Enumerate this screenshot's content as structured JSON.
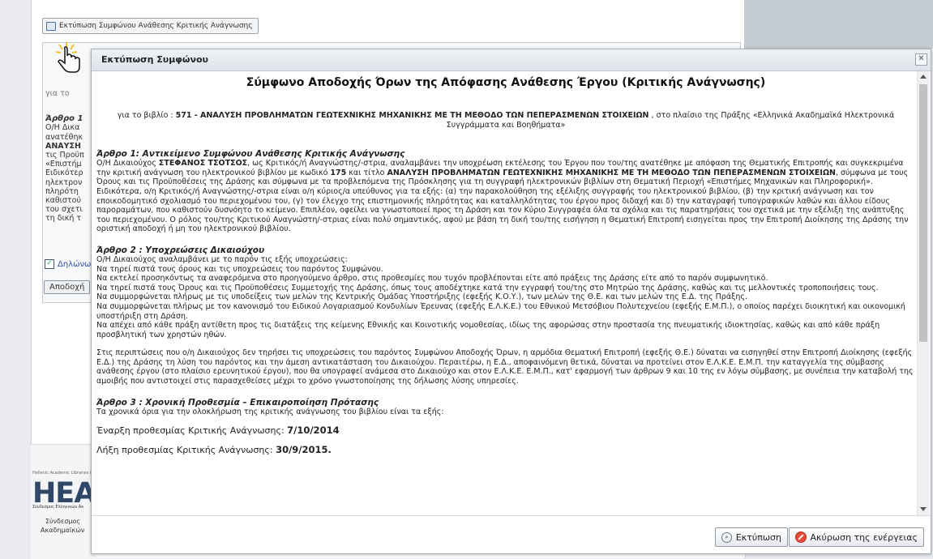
{
  "background": {
    "print_button_label": "Εκτύπωση Συμφώνου Ανάθεσης Κριτικής Ανάγνωσης",
    "side_text": [
      "για το",
      "Άρθρο 1",
      "Ο/Η Δικα",
      "ανατέθηκ",
      "ΑΝΑΥΣΗ",
      "τις Προϋπ",
      "«Επιστήμ",
      "Ειδικότερ",
      "ηλεκτρον",
      "πληρότη",
      "καθιστού",
      "του σχετι",
      "τη δική τ"
    ],
    "declaration_label": "Δηλώνω",
    "accept_button": "Αποδοχή",
    "footer": {
      "tiny": "Hellenic Academic Libraries Link",
      "logo": "HEAL",
      "sub": "Σύνδεσμος Ελληνικών Ακ",
      "line1": "Σύνδεσμος",
      "line2": "Ακαδημαϊκών"
    }
  },
  "dialog": {
    "title": "Εκτύπωση Συμφώνου",
    "close": "✕",
    "heading": "Σύμφωνο Αποδοχής Όρων της Απόφασης Ανάθεσης Έργου (Κριτικής Ανάγνωσης)",
    "intro": {
      "prefix": "για το βιβλίο : ",
      "book": "571 - ΑΝΑΛΥΣΗ ΠΡΟΒΛΗΜΑΤΩΝ ΓΕΩΤΕΧΝΙΚΗΣ ΜΗΧΑΝΙΚΗΣ ΜΕ ΤΗ ΜΕΘΟΔΟ ΤΩΝ ΠΕΠΕΡΑΣΜΕΝΩΝ ΣΤΟΙΧΕΙΩΝ",
      "suffix": " , στο πλαίσιο της Πράξης «Ελληνικά Ακαδημαϊκά Ηλεκτρονικά Συγγράμματα και Βοηθήματα»"
    },
    "article1": {
      "title": "Άρθρο 1: Αντικείμενο Συμφώνου Ανάθεσης Κριτικής Ανάγνωσης",
      "p1_a": "Ο/Η Δικαιούχος ",
      "name": "ΣΤΕΦΑΝΟΣ ΤΣΟΤΣΟΣ",
      "p1_b": ", ως Κριτικός/ή Αναγνώστης/-στρια, αναλαμβάνει την υποχρέωση εκτέλεσης του Έργου που του/της ανατέθηκε με απόφαση της Θεματικής Επιτροπής και συγκεκριμένα την κριτική ανάγνωση του ηλεκτρονικού βιβλίου με κωδικό ",
      "code": "175",
      "p1_c": " και τίτλο ",
      "title_book": "ΑΝΑΛΥΣΗ ΠΡΟΒΛΗΜΑΤΩΝ ΓΕΩΤΕΧΝΙΚΗΣ ΜΗΧΑΝΙΚΗΣ ΜΕ ΤΗ ΜΕΘΟΔΟ ΤΩΝ ΠΕΠΕΡΑΣΜΕΝΩΝ ΣΤΟΙΧΕΙΩΝ",
      "p1_d": ", σύμφωνα με τους Όρους και τις Προϋποθέσεις της Δράσης και σύμφωνα με τα προβλεπόμενα της Πρόσκλησης για τη συγγραφή ηλεκτρονικών βιβλίων στη Θεματική Περιοχή «Επιστήμες Μηχανικών και Πληροφορική».",
      "p2": "Ειδικότερα, ο/η Κριτικός/ή Αναγνώστης/-στρια είναι ο/η κύριος/α υπεύθυνος για τα εξής: (α) την παρακολούθηση της εξέλιξης συγγραφής του ηλεκτρονικού βιβλίου, (β) την κριτική ανάγνωση και τον εποικοδομητικό σχολιασμό του περιεχομένου του, (γ) τον έλεγχο της επιστημονικής πληρότητας και καταλληλότητας του έργου προς διδαχή και δ) την καταγραφή τυπογραφικών λαθών και άλλου είδους παροραμάτων, που καθιστούν δυσνόητο το κείμενο. Επιπλέον, οφείλει να γνωστοποιεί προς τη Δράση και τον Κύριο Συγγραφέα όλα τα σχόλια και τις παρατηρήσεις του σχετικά με την εξέλιξη της ανάπτυξης του περιεχομένου. Ο ρόλος του/της Κριτικού Αναγνώστη/-στριας είναι πολύ σημαντικός, αφού με βάση τη δική του/της εισήγηση η Θεματική Επιτροπή εισηγείται προς την Επιτροπή Διοίκησης της Δράσης την οριστική αποδοχή ή μη του ηλεκτρονικού βιβλίου."
    },
    "article2": {
      "title": "Άρθρο 2 : Υποχρεώσεις Δικαιούχου",
      "lines": [
        "Ο/Η Δικαιούχος αναλαμβάνει με το παρόν τις εξής υποχρεώσεις:",
        "Να τηρεί πιστά τους όρους και τις υποχρεώσεις του παρόντος Συμφώνου.",
        "Να εκτελεί προσηκόντως τα αναφερόμενα στο προηγούμενο άρθρο, στις προθεσμίες που τυχόν προβλέπονται είτε από πράξεις της Δράσης είτε από το παρόν συμφωνητικό.",
        "Να τηρεί πιστά τους Όρους και τις Προϋποθέσεις Συμμετοχής της Δράσης, όπως τους αποδέχτηκε κατά την εγγραφή του/της στο Μητρώο της Δράσης, καθώς και τις μελλοντικές τροποποιήσεις τους.",
        "Να συμμορφώνεται πλήρως με τις υποδείξεις των μελών της Κεντρικής Ομάδας Υποστήριξης (εφεξής Κ.Ο.Υ.), των μελών της Θ.Ε. και των μελών της Ε.Δ. της Πράξης.",
        "Να συμμορφώνεται πλήρως με τον κανονισμό του Ειδικού Λογαριασμού Κονδυλίων Έρευνας (εφεξής Ε.Λ.Κ.Ε.) του Εθνικού Μετσόβιου Πολυτεχνείου (εφεξής Ε.Μ.Π.), ο οποίος παρέχει διοικητική και οικονομική υποστήριξη στη Δράση.",
        "Να απέχει από κάθε πράξη αντίθετη προς τις διατάξεις της κείμενης Εθνικής και Κοινοτικής νομοθεσίας, ιδίως της αφορώσας στην προστασία της πνευματικής ιδιοκτησίας, καθώς και από κάθε πράξη προσβλητική των χρηστών ηθών."
      ],
      "closing": "Στις περιπτώσεις που ο/η Δικαιούχος δεν τηρήσει τις υποχρεώσεις του παρόντος Συμφώνου Αποδοχής Όρων, η αρμόδια Θεματική Επιτροπή (εφεξής Θ.Ε.) δύναται να εισηγηθεί στην Επιτροπή Διοίκησης (εφεξής Ε.Δ.) της Δράσης τη λύση του παρόντος και την άμεση αντικατάσταση του Δικαιούχου. Περαιτέρω, η Ε.Δ., αποφαινόμενη θετικά, δύναται να προτείνει στον Ε.Λ.Κ.Ε. Ε.Μ.Π. την καταγγελία της σύμβασης ανάθεσης έργου (στο πλαίσιο ερευνητικού έργου), που θα υπογραφεί ανάμεσα στο Δικαιούχο και στον Ε.Λ.Κ.Ε. Ε.Μ.Π., κατ' εφαρμογή των άρθρων 9 και 10 της εν λόγω σύμβασης, με συνέπεια την καταβολή της αμοιβής που αντιστοιχεί στις παρασχεθείσες μέχρι το χρόνο γνωστοποίησης της δήλωσης λύσης υπηρεσίες."
    },
    "article3": {
      "title": "Άρθρο 3 : Χρονική Προθεσμία – Επικαιροποίηση Πρότασης",
      "intro": "Τα χρονικά όρια για την ολοκλήρωση της κριτικής ανάγνωσης του βιβλίου είναι τα εξής:",
      "start_label": "Έναρξη προθεσμίας Κριτικής Ανάγνωσης: ",
      "start_date": "7/10/2014",
      "end_label": "Λήξη προθεσμίας Κριτικής Ανάγνωσης: ",
      "end_date": "30/9/2015."
    },
    "buttons": {
      "print": "Εκτύπωση",
      "cancel": "Ακύρωση της ενέργειας"
    }
  },
  "icons": [
    "printer-icon",
    "close-icon",
    "pointer-hand-icon",
    "print-button-icon",
    "cancel-icon",
    "scroll-up-icon",
    "scroll-down-icon",
    "checkbox-icon"
  ]
}
